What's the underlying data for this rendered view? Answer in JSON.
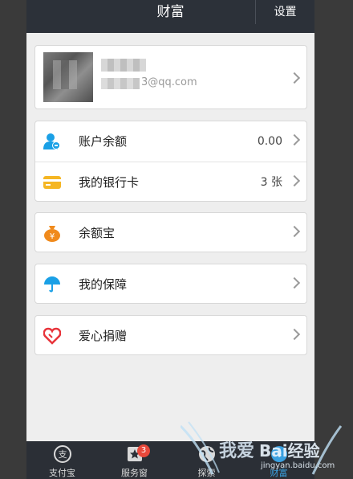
{
  "header": {
    "title": "财富",
    "settings_label": "设置"
  },
  "profile": {
    "email_visible": "3@qq.com"
  },
  "balance_card": {
    "items": [
      {
        "label": "账户余额",
        "value": "0.00"
      },
      {
        "label": "我的银行卡",
        "value": "3 张"
      }
    ]
  },
  "menu": {
    "yuebao": "余额宝",
    "protection": "我的保障",
    "donation": "爱心捐赠"
  },
  "tabs": [
    {
      "label": "支付宝"
    },
    {
      "label": "服务窗",
      "badge": "3"
    },
    {
      "label": "探索"
    },
    {
      "label": "财富"
    }
  ],
  "watermark": {
    "text": "Bai经验",
    "site": "jingyan.baidu.com"
  },
  "colors": {
    "topbar": "#2c3139",
    "tabbar": "#2b2f36",
    "badge": "#e8483b",
    "blue": "#1aa0e6",
    "orange": "#f08a1c",
    "yellow": "#f5b623",
    "red": "#e8333a"
  }
}
